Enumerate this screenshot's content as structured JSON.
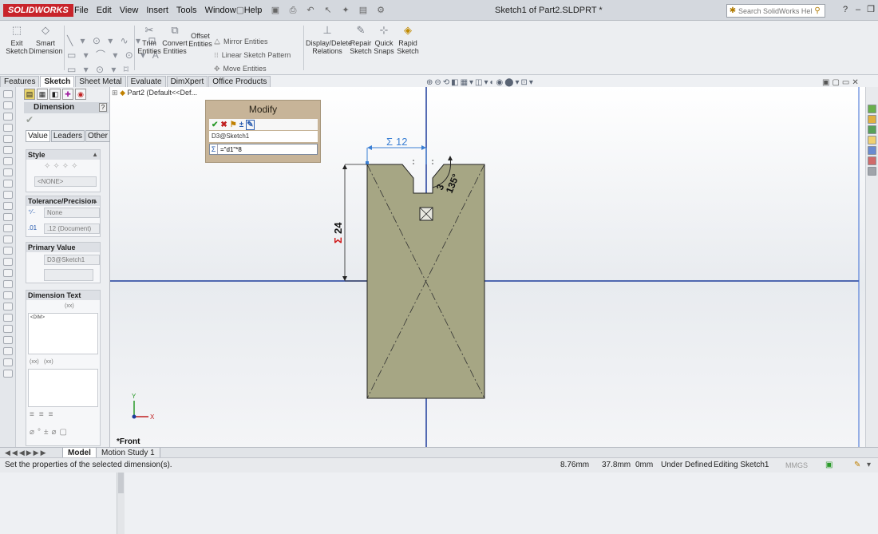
{
  "app": {
    "logo": "SOLIDWORKS",
    "doc_title": "Sketch1 of Part2.SLDPRT *"
  },
  "menu": [
    "File",
    "Edit",
    "View",
    "Insert",
    "Tools",
    "Window",
    "Help"
  ],
  "search": {
    "placeholder": "Search SolidWorks Help"
  },
  "toolbar": {
    "exit_sketch": [
      "Exit",
      "Sketch"
    ],
    "smart_dimension": [
      "Smart",
      "Dimension"
    ],
    "trim_entities": [
      "Trim",
      "Entities"
    ],
    "convert_entities": [
      "Convert",
      "Entities"
    ],
    "offset_entities": [
      "Offset",
      "Entities"
    ],
    "mirror_entities": "Mirror Entities",
    "linear_sketch_pattern": "Linear Sketch Pattern",
    "move_entities": "Move Entities",
    "display_delete_relations": [
      "Display/Delete",
      "Relations"
    ],
    "repair_sketch": [
      "Repair",
      "Sketch"
    ],
    "quick_snaps": [
      "Quick",
      "Snaps"
    ],
    "rapid_sketch": [
      "Rapid",
      "Sketch"
    ]
  },
  "cmd_tabs": [
    "Features",
    "Sketch",
    "Sheet Metal",
    "Evaluate",
    "DimXpert",
    "Office Products"
  ],
  "property_manager": {
    "title": "Dimension",
    "help": "?",
    "tabs": [
      "Value",
      "Leaders",
      "Other"
    ],
    "style": {
      "header": "Style",
      "value": "<NONE>"
    },
    "tolerance": {
      "header": "Tolerance/Precision",
      "tolerance_type": "None",
      "precision": ".12 (Document)"
    },
    "primary_value": {
      "header": "Primary Value",
      "value": "D3@Sketch1"
    },
    "dimension_text": {
      "header": "Dimension Text",
      "text": "<DIM>",
      "buttons": [
        "(xx)",
        "(xx)",
        "(xx)"
      ]
    }
  },
  "feature_tree": {
    "item": "Part2  (Default<<Def..."
  },
  "modify_dialog": {
    "title": "Modify",
    "dimension_name": "D3@Sketch1",
    "equation": "=\"d1\"*8"
  },
  "sketch": {
    "dim_width": "12",
    "dim_height": "24",
    "dim_small": "3",
    "dim_angle": "135°",
    "sigma": "Σ"
  },
  "view": {
    "label": "*Front",
    "axis_y": "Y",
    "axis_x": "X"
  },
  "bottom_tabs": [
    "Model",
    "Motion Study 1"
  ],
  "status": {
    "message": "Set the properties of the selected dimension(s).",
    "x": "8.76mm",
    "y": "37.8mm",
    "z": "0mm",
    "state": "Under Defined",
    "mode": "Editing Sketch1",
    "units": "MMGS"
  },
  "colors": {
    "brand": "#c8242b",
    "part_fill": "#a6a684",
    "dim_blue": "#3a7fd4",
    "dim_red": "#d01818",
    "axis_blue": "#1e3d9c"
  }
}
